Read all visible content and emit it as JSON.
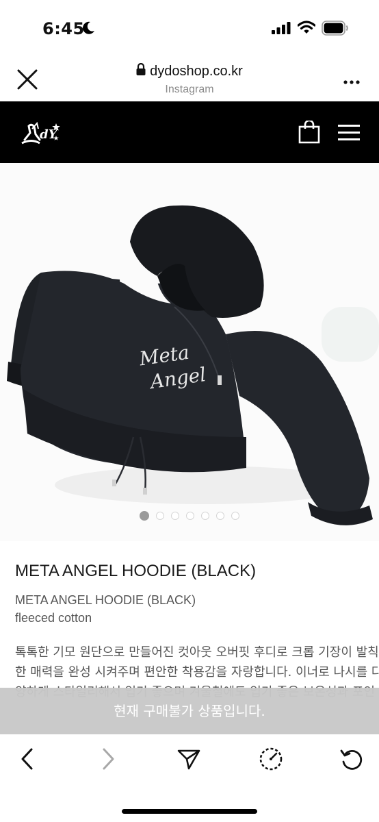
{
  "status": {
    "time": "6:45"
  },
  "browser": {
    "domain": "dydoshop.co.kr",
    "source": "Instagram"
  },
  "product": {
    "title": "META ANGEL HOODIE (BLACK)",
    "subtitle": "META ANGEL HOODIE (BLACK)",
    "material": "fleeced cotton",
    "description_lines": [
      "톡톡한 기모 원단으로 만들어진 컷아웃 오버핏 후디로 크롭 기장이 발칙",
      "한 매력을 완성 시켜주며 편안한 착용감을 자랑합니다. 이너로 나시를 다",
      "양하게 스타일리해서 입기 좋으며 겨울철에도 입기 좋은 보온성과 포인"
    ],
    "print_text": [
      "Meta",
      "Angel"
    ],
    "carousel": {
      "total": 7,
      "active": 1
    }
  },
  "notice": {
    "text": "현재 구매불가 상품입니다."
  },
  "icons": {
    "moon": "moon-icon",
    "signal": "cellular-signal-icon",
    "wifi": "wifi-icon",
    "battery": "battery-icon",
    "close": "close-icon",
    "lock": "lock-icon",
    "more": "more-icon",
    "bag": "shopping-bag-icon",
    "menu": "hamburger-menu-icon",
    "back": "back-icon",
    "forward": "forward-icon",
    "share": "send-icon",
    "speed": "speedometer-icon",
    "reload": "reload-icon"
  },
  "colors": {
    "header_bg": "#000000",
    "overlay_bg": "#c8c8c8",
    "hoodie": "#1f2126"
  }
}
